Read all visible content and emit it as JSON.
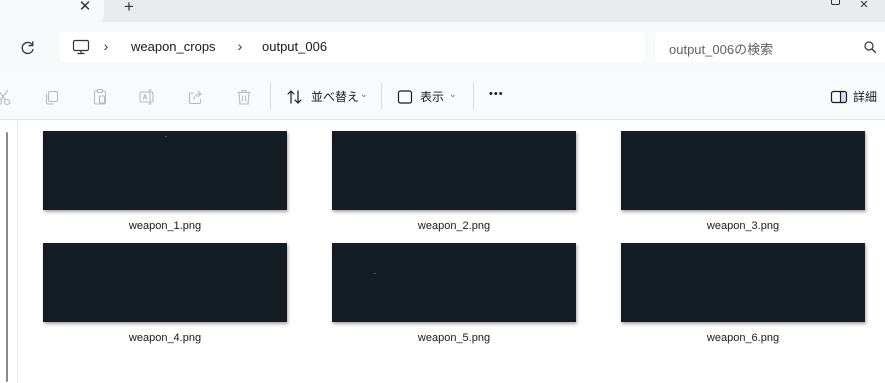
{
  "tabs": {
    "close_glyph": "✕",
    "new_tab_glyph": "+"
  },
  "address": {
    "crumbs": [
      "weapon_crops",
      "output_006"
    ],
    "separator": "›"
  },
  "search": {
    "placeholder": "output_006の検索"
  },
  "toolbar": {
    "sort_label": "並べ替え",
    "view_label": "表示",
    "more_label": "•••",
    "details_label": "詳細"
  },
  "files": [
    {
      "name": "weapon_1.png"
    },
    {
      "name": "weapon_2.png"
    },
    {
      "name": "weapon_3.png"
    },
    {
      "name": "weapon_4.png"
    },
    {
      "name": "weapon_5.png"
    },
    {
      "name": "weapon_6.png"
    }
  ],
  "colors": {
    "thumbnail_bg": "#131b23",
    "accent": "#0067c0",
    "tabstrip_bg": "#e8ecef"
  }
}
